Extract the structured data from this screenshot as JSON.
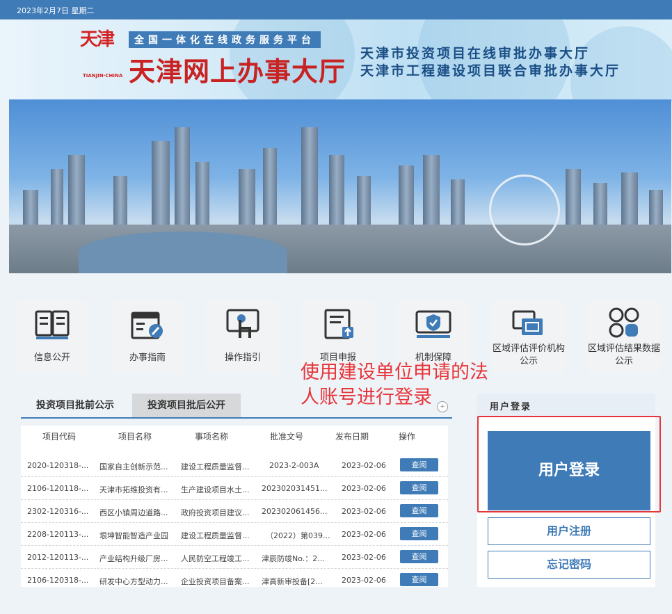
{
  "topbar": {
    "date": "2023年2月7日 星期二"
  },
  "header": {
    "logo_text": "天津",
    "logo_sub": "TIANJIN·CHINA",
    "slogan": "全国一体化在线政务服务平台",
    "title": "天津网上办事大厅",
    "right_line1": "天津市投资项目在线审批办事大厅",
    "right_line2": "天津市工程建设项目联合审批办事大厅"
  },
  "icons": [
    {
      "label": "信息公开",
      "icon": "book-icon"
    },
    {
      "label": "办事指南",
      "icon": "calendar-edit-icon"
    },
    {
      "label": "操作指引",
      "icon": "touch-screen-icon"
    },
    {
      "label": "项目申报",
      "icon": "document-upload-icon"
    },
    {
      "label": "机制保障",
      "icon": "shield-check-icon"
    },
    {
      "label": "区域评估评价机构公示",
      "icon": "windows-icon"
    },
    {
      "label": "区域评估结果数据公示",
      "icon": "grid-icon"
    }
  ],
  "annotation": "使用建设单位申请的法人账号进行登录",
  "tabs": [
    "投资项目批前公示",
    "投资项目批后公开"
  ],
  "table": {
    "headers": [
      "项目代码",
      "项目名称",
      "事项名称",
      "批准文号",
      "发布日期",
      "操作"
    ],
    "rows": [
      [
        "2020-120318-...",
        "国家自主创新示范...",
        "建设工程质量监督...",
        "2023-2-003A",
        "2023-02-06",
        "查阅"
      ],
      [
        "2106-120118-...",
        "天津市拓维投资有...",
        "生产建设项目水土...",
        "202302031451...",
        "2023-02-06",
        "查阅"
      ],
      [
        "2302-120316-...",
        "西区小镇周边道路...",
        "政府投资项目建议...",
        "202302061456...",
        "2023-02-06",
        "查阅"
      ],
      [
        "2208-120113-...",
        "垠坤智能智造产业园",
        "建设工程质量监督...",
        "（2022）第039...",
        "2023-02-06",
        "查阅"
      ],
      [
        "2012-120113-...",
        "产业结构升级厂房...",
        "人民防空工程竣工...",
        "津辰防竣No.：2...",
        "2023-02-06",
        "查阅"
      ],
      [
        "2106-120318-...",
        "研发中心方型动力...",
        "企业投资项目备案...",
        "津高新审投备[2...",
        "2023-02-06",
        "查阅"
      ]
    ]
  },
  "login": {
    "title": "用户登录",
    "login_button": "用户登录",
    "register_button": "用户注册",
    "forgot_button": "忘记密码"
  },
  "colors": {
    "primary": "#3f7bb7",
    "annotation": "#e6353a",
    "title_red": "#c82222"
  }
}
